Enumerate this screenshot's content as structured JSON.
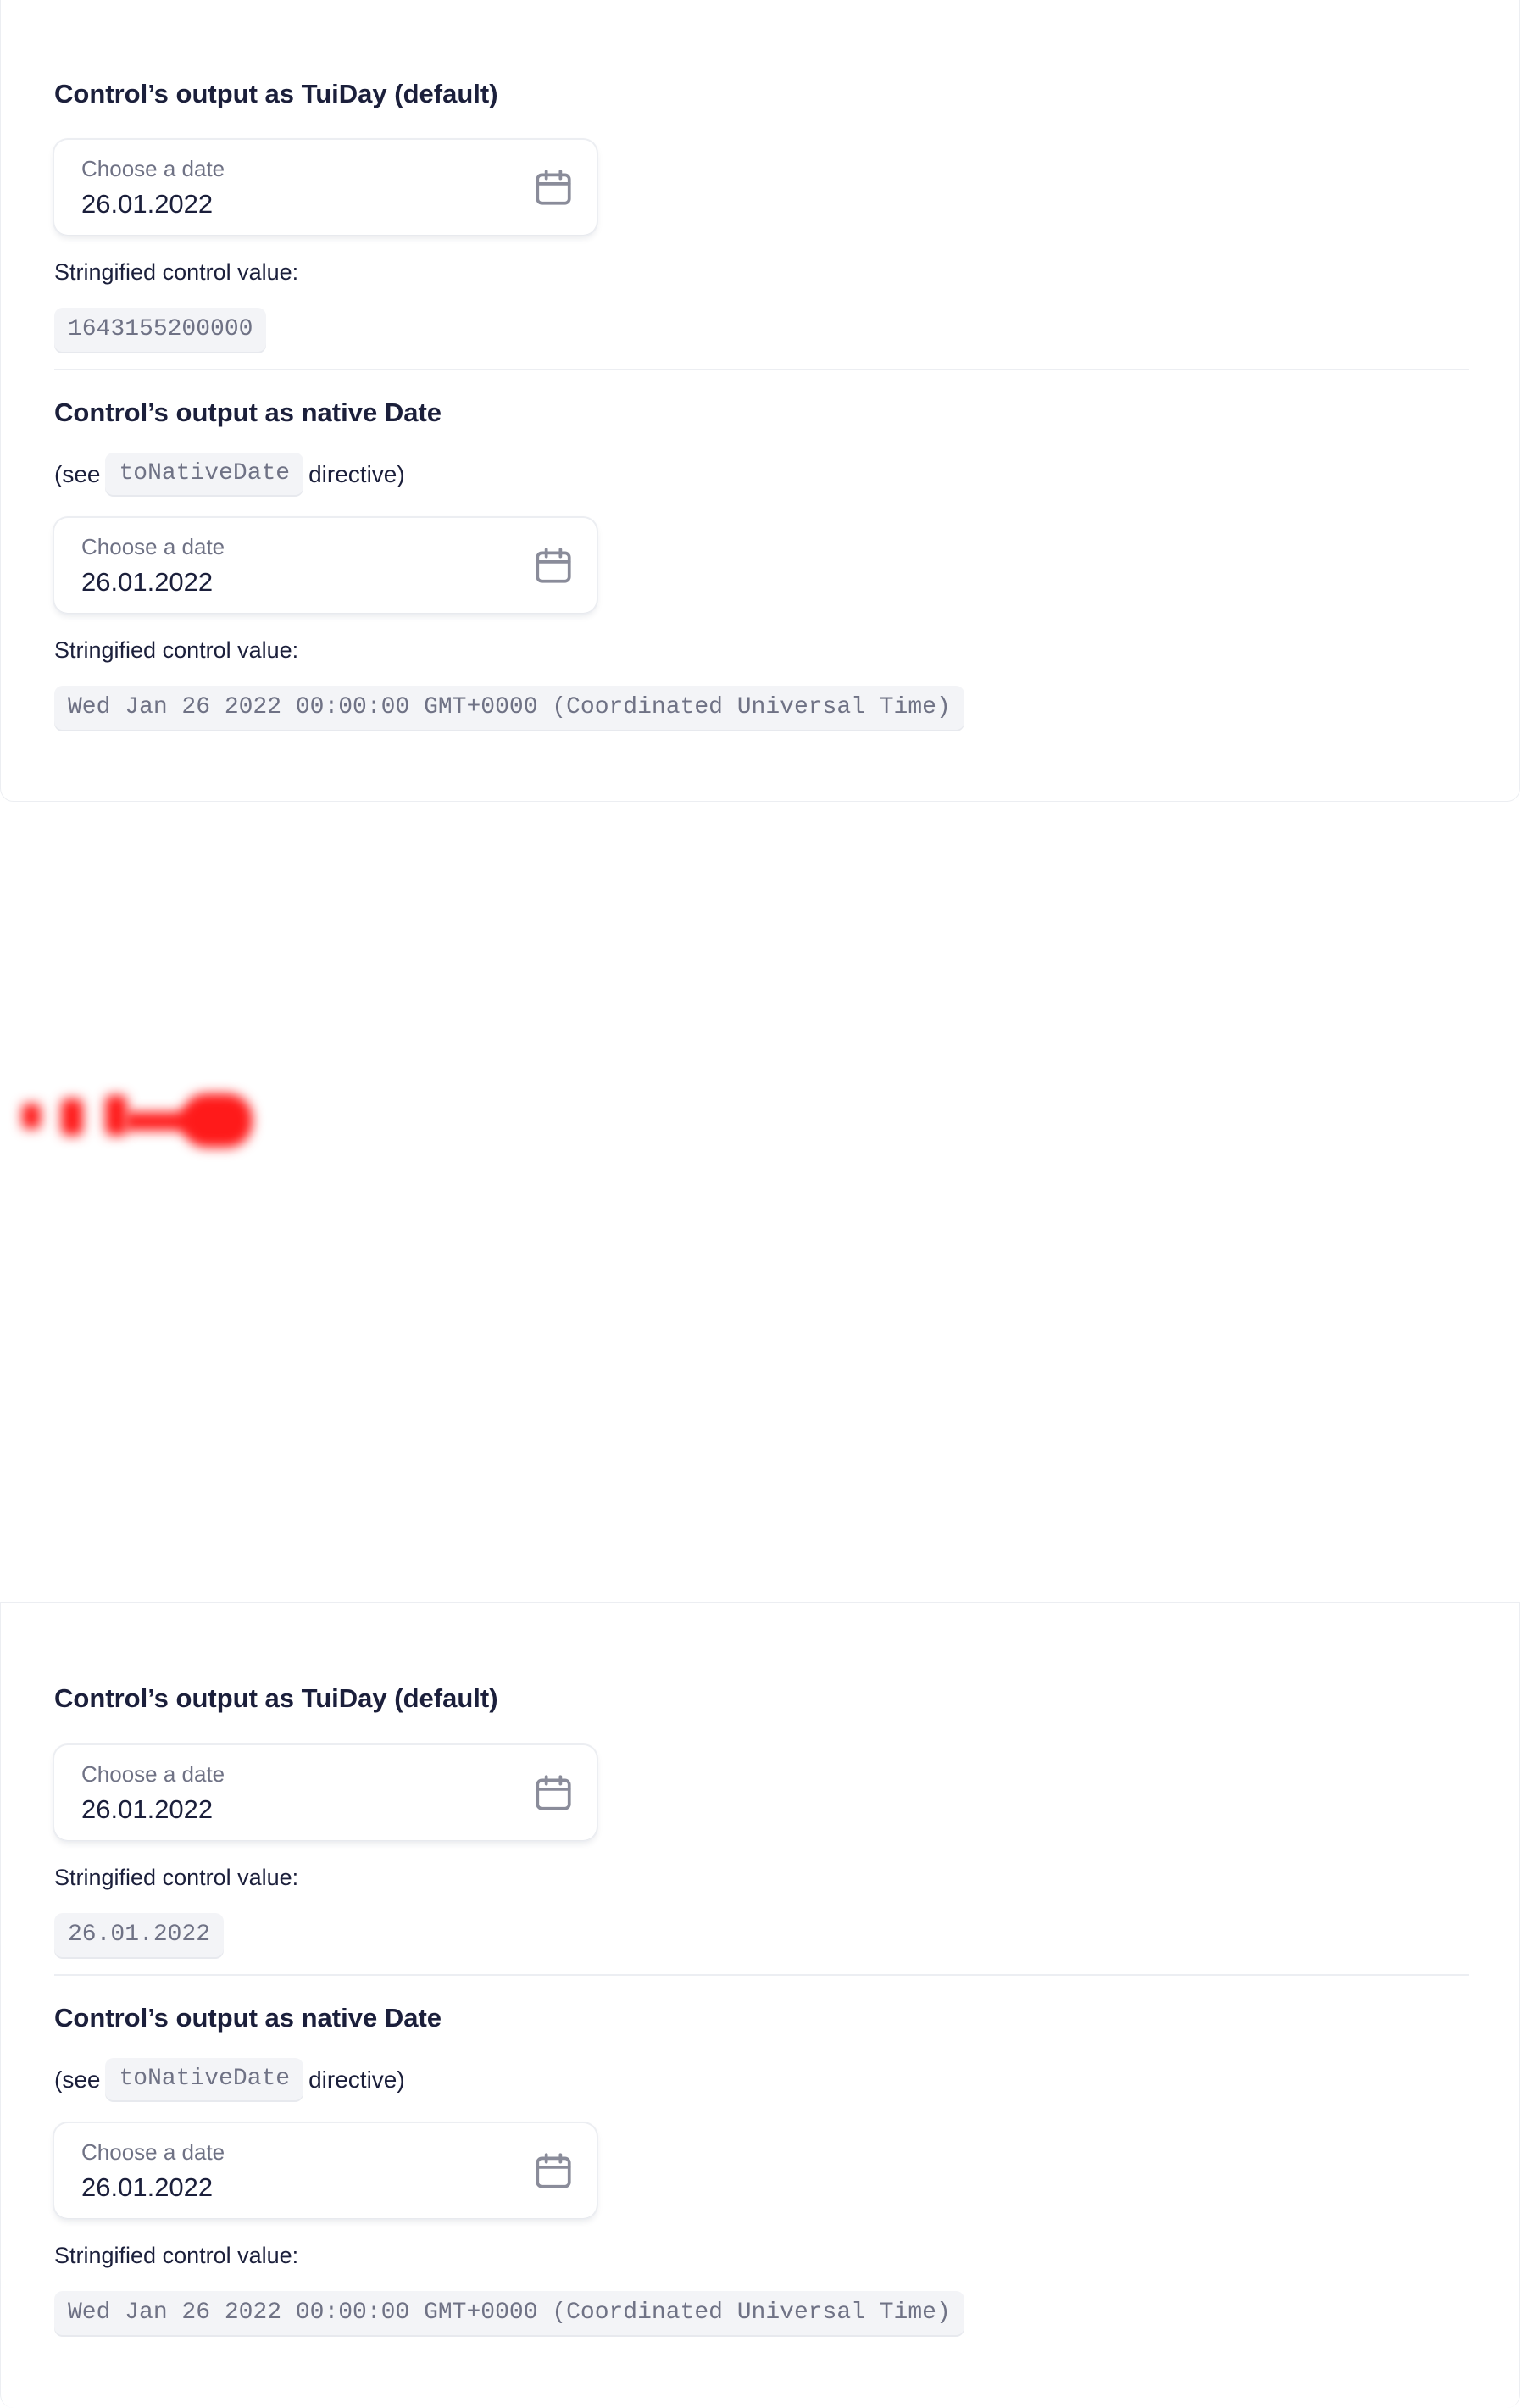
{
  "colors": {
    "text": "#1b1f3b",
    "muted": "#6f7285",
    "code_bg": "#f3f4f7",
    "divider": "#eceef2",
    "blurred_mark": "#ff1a1a"
  },
  "panels": [
    {
      "tuiday_section": {
        "title": "Control’s output as TuiDay (default)",
        "field": {
          "label": "Choose a date",
          "value": "26.01.2022",
          "icon": "calendar-icon"
        },
        "caption": "Stringified control value:",
        "stringified_value": "1643155200000"
      },
      "native_section": {
        "title": "Control’s output as native Date",
        "see_prefix": "(see",
        "see_code": "toNativeDate",
        "see_suffix": "directive)",
        "field": {
          "label": "Choose a date",
          "value": "26.01.2022",
          "icon": "calendar-icon"
        },
        "caption": "Stringified control value:",
        "stringified_value": "Wed Jan 26 2022 00:00:00 GMT+0000 (Coordinated Universal Time)"
      }
    },
    {
      "tuiday_section": {
        "title": "Control’s output as TuiDay (default)",
        "field": {
          "label": "Choose a date",
          "value": "26.01.2022",
          "icon": "calendar-icon"
        },
        "caption": "Stringified control value:",
        "stringified_value": "26.01.2022"
      },
      "native_section": {
        "title": "Control’s output as native Date",
        "see_prefix": "(see",
        "see_code": "toNativeDate",
        "see_suffix": "directive)",
        "field": {
          "label": "Choose a date",
          "value": "26.01.2022",
          "icon": "calendar-icon"
        },
        "caption": "Stringified control value:",
        "stringified_value": "Wed Jan 26 2022 00:00:00 GMT+0000 (Coordinated Universal Time)"
      }
    }
  ]
}
